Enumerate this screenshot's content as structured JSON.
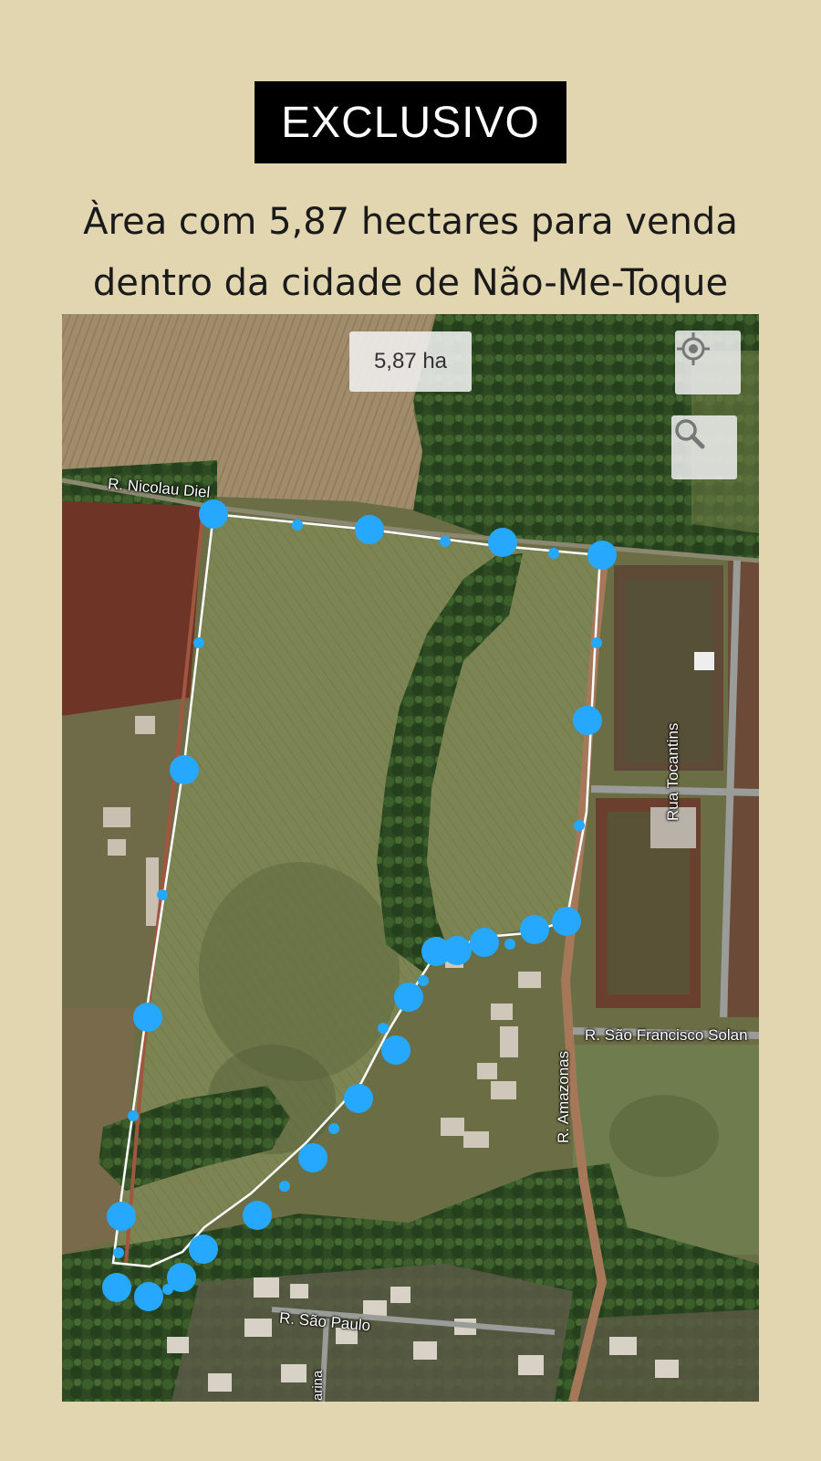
{
  "header": {
    "badge": "EXCLUSIVO",
    "headline_line1": "Àrea com 5,87 hectares para venda",
    "headline_line2": "dentro da cidade de Não-Me-Toque"
  },
  "map": {
    "area_chip": "5,87 ha",
    "buttons": {
      "locate_icon": "crosshair-icon",
      "search_icon": "search-icon"
    },
    "roads": {
      "nicolau": "R. Nicolau Diel",
      "tocantins": "Rua Tocantins",
      "sao_francisco": "R. São Francisco Solan",
      "amazonas": "R. Amazonas",
      "sao_paulo": "R. São Paulo",
      "marina": "arina"
    },
    "colors": {
      "marker": "#26a8ff",
      "boundary": "#ffffff",
      "field": "#7d8553",
      "forest": "#2f4a22"
    }
  }
}
